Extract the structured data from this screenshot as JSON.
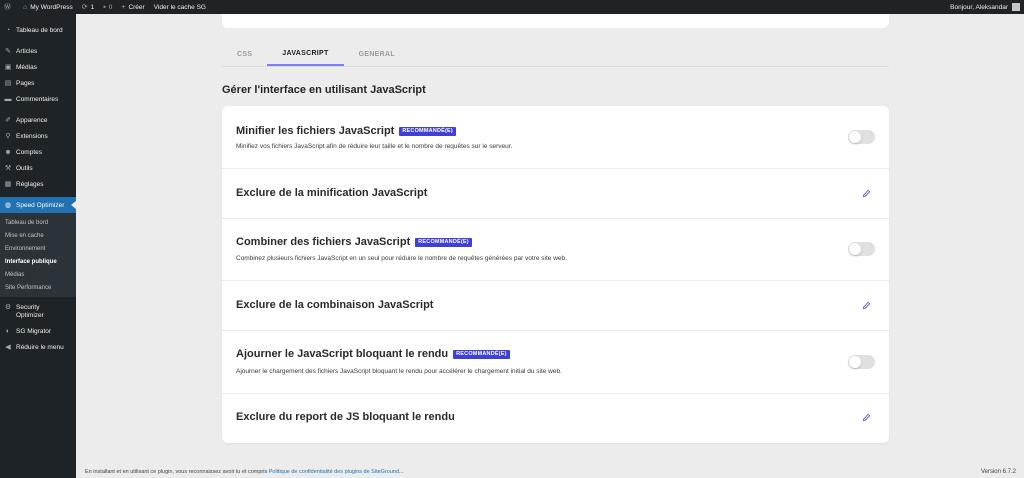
{
  "adminbar": {
    "site_name": "My WordPress",
    "updates_count": "1",
    "comments_count": "0",
    "new_label": "Créer",
    "cache_label": "Vider le cache SG",
    "greeting": "Bonjour, Aleksandar"
  },
  "sidebar": {
    "items": [
      {
        "label": "Tableau de bord",
        "icon": "dashboard-icon"
      },
      {
        "label": "Articles",
        "icon": "pin-icon"
      },
      {
        "label": "Médias",
        "icon": "media-icon"
      },
      {
        "label": "Pages",
        "icon": "page-icon"
      },
      {
        "label": "Commentaires",
        "icon": "comment-icon"
      },
      {
        "label": "Apparence",
        "icon": "brush-icon"
      },
      {
        "label": "Extensions",
        "icon": "plugin-icon"
      },
      {
        "label": "Comptes",
        "icon": "users-icon"
      },
      {
        "label": "Outils",
        "icon": "wrench-icon"
      },
      {
        "label": "Réglages",
        "icon": "settings-icon"
      },
      {
        "label": "Speed Optimizer",
        "icon": "speed-icon"
      },
      {
        "label": "Security Optimizer",
        "icon": "gear-icon"
      },
      {
        "label": "SG Migrator",
        "icon": "migrator-icon"
      },
      {
        "label": "Réduire le menu",
        "icon": "collapse-icon"
      }
    ],
    "submenu": [
      "Tableau de bord",
      "Mise en cache",
      "Environnement",
      "Interface publique",
      "Médias",
      "Site Performance"
    ]
  },
  "tabs": [
    "CSS",
    "JAVASCRIPT",
    "GENERAL"
  ],
  "active_tab": "JAVASCRIPT",
  "section_title": "Gérer l'interface en utilisant JavaScript",
  "badge_label": "RECOMMANDÉ(E)",
  "rows": [
    {
      "title": "Minifier les fichiers JavaScript",
      "desc": "Minifiez vos fichiers JavaScript afin de réduire leur taille et le nombre de requêtes sur le serveur.",
      "toggle": false
    },
    {
      "title": "Exclure de la minification JavaScript"
    },
    {
      "title": "Combiner des fichiers JavaScript",
      "desc": "Combinez plusieurs fichiers JavaScript en un seul pour réduire le nombre de requêtes générées par votre site web.",
      "toggle": false
    },
    {
      "title": "Exclure de la combinaison JavaScript"
    },
    {
      "title": "Ajourner le JavaScript bloquant le rendu",
      "desc": "Ajourner le chargement des fichiers JavaScript bloquant le rendu pour accélérer le chargement initial du site web.",
      "toggle": false
    },
    {
      "title": "Exclure du report de JS bloquant le rendu"
    }
  ],
  "footer": {
    "text": "En installant et en utilisant ce plugin, vous reconnaissez avoir lu et compris",
    "link": "Politique de confidentialité des plugins de SiteGround",
    "ellipsis": "...",
    "version": "Version 6.7.2"
  },
  "colors": {
    "admin_bg": "#1d2327",
    "active_menu": "#2271b1",
    "badge": "#3f3fd9",
    "tab_underline": "#7c7cf5",
    "edit_icon": "#5a5ae0"
  }
}
